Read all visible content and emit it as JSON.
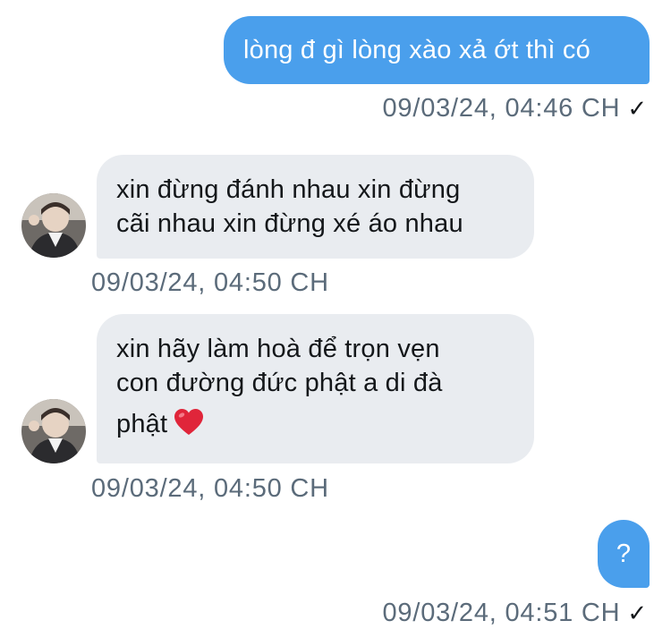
{
  "messages": [
    {
      "direction": "sent",
      "text": "lòng đ gì lòng xào xả ớt thì có",
      "time": "09/03/24, 04:46 CH",
      "status": "✓"
    },
    {
      "direction": "received",
      "line1": "xin đừng đánh nhau xin đừng",
      "line2": "cãi nhau xin đừng xé áo nhau",
      "time": "09/03/24, 04:50 CH"
    },
    {
      "direction": "received",
      "line1": "xin hãy làm hoà để trọn vẹn",
      "line2": "con đường đức phật a di đà",
      "line3": "phật",
      "emoji": "heart-emoji",
      "time": "09/03/24, 04:50 CH"
    },
    {
      "direction": "sent",
      "text": "?",
      "time": "09/03/24, 04:51 CH",
      "status": "✓"
    }
  ],
  "colors": {
    "sent_bubble": "#4a9fec",
    "received_bubble": "#e9ecf0",
    "timestamp": "#5b6b7a",
    "heart": "#e0253a"
  }
}
